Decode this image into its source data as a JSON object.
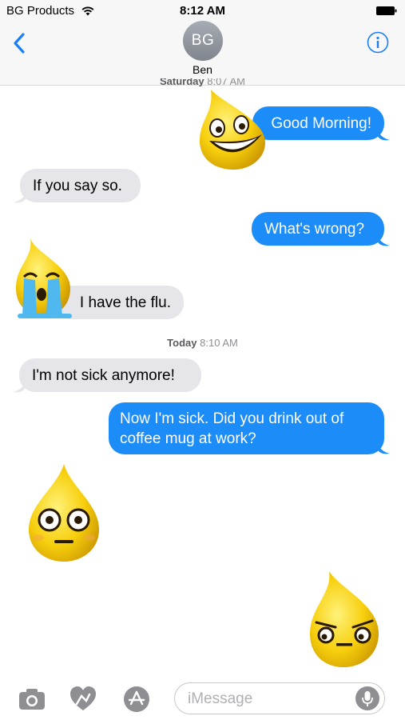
{
  "status_bar": {
    "carrier": "BG Products",
    "time": "8:12 AM"
  },
  "header": {
    "avatar_initials": "BG",
    "contact_name": "Ben"
  },
  "timestamps": [
    {
      "day": "Saturday",
      "time": "8:07 AM"
    },
    {
      "day": "Today",
      "time": "8:10 AM"
    }
  ],
  "messages": [
    {
      "direction": "out",
      "text": "Good Morning!"
    },
    {
      "direction": "in",
      "text": "If you say so."
    },
    {
      "direction": "out",
      "text": "What's wrong?"
    },
    {
      "direction": "in",
      "text": "I have the flu."
    },
    {
      "direction": "in",
      "text": "I'm not sick anymore!"
    },
    {
      "direction": "out",
      "text": "Now I'm sick. Did you drink out of coffee mug at work?"
    }
  ],
  "stickers": [
    "grinning-drop-emoji",
    "crying-drop-emoji",
    "shocked-drop-emoji",
    "suspicious-drop-emoji"
  ],
  "input": {
    "placeholder": "iMessage"
  },
  "colors": {
    "outgoing": "#1c8cf8",
    "incoming": "#e5e5ea",
    "accent": "#1a7ff5"
  }
}
